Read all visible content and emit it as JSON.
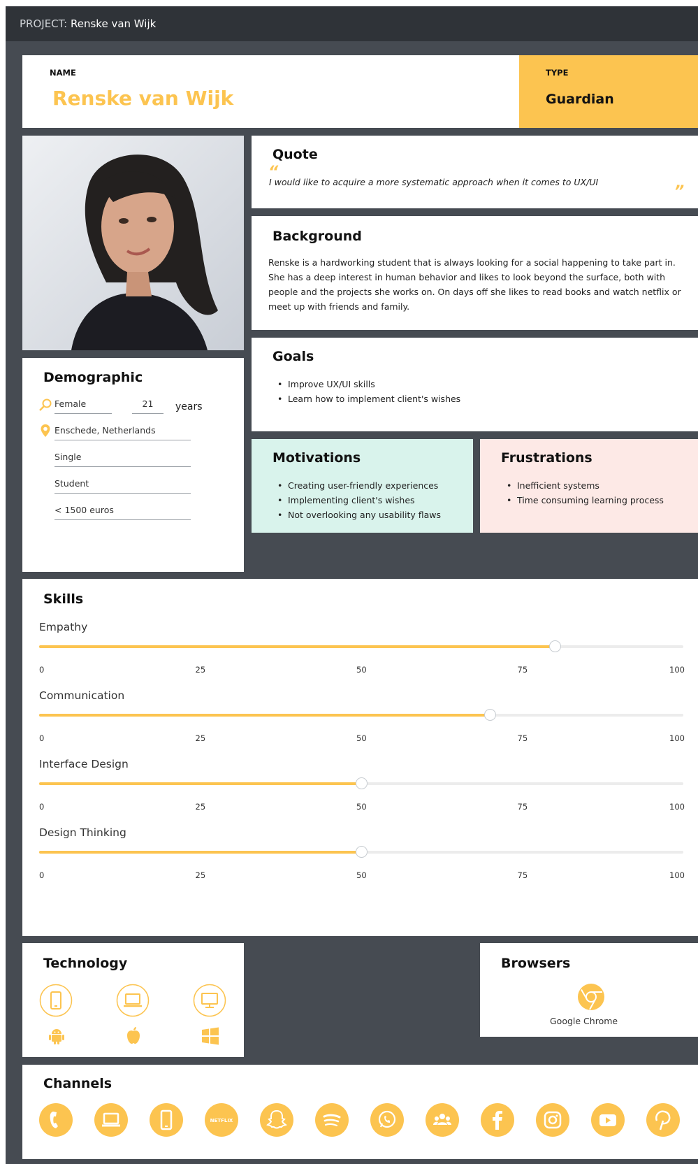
{
  "topbar": {
    "prefix": "PROJECT:",
    "project_name": "Renske van Wijk"
  },
  "header": {
    "name_label": "NAME",
    "name_value": "Renske van Wijk",
    "type_label": "TYPE",
    "type_value": "Guardian"
  },
  "quote": {
    "title": "Quote",
    "open_mark": "“",
    "text": "I would like to acquire a more systematic approach when it comes to UX/UI",
    "close_mark": "”"
  },
  "background": {
    "title": "Background",
    "text": "Renske is a hardworking student that is always looking for a social happening to take part in. She has a deep interest in human behavior and likes to look beyond the surface, both with people and the projects she works on. On days off she likes to read books and watch netflix or meet up with friends and family."
  },
  "goals": {
    "title": "Goals",
    "items": [
      "Improve UX/UI skills",
      "Learn how to implement client's wishes"
    ]
  },
  "demographic": {
    "title": "Demographic",
    "gender": "Female",
    "age": "21",
    "age_unit": "years",
    "location": "Enschede, Netherlands",
    "relationship": "Single",
    "occupation": "Student",
    "income": "< 1500 euros",
    "gender_icon": "female-search-icon",
    "location_icon": "location-pin-icon"
  },
  "motivations": {
    "title": "Motivations",
    "items": [
      "Creating user-friendly experiences",
      "Implementing client's wishes",
      "Not overlooking any usability flaws"
    ]
  },
  "frustrations": {
    "title": "Frustrations",
    "items": [
      "Inefficient systems",
      "Time consuming learning process"
    ]
  },
  "skills": {
    "title": "Skills",
    "ticks": [
      "0",
      "25",
      "50",
      "75",
      "100"
    ],
    "items": [
      {
        "name": "Empathy",
        "value": 80
      },
      {
        "name": "Communication",
        "value": 70
      },
      {
        "name": "Interface Design",
        "value": 50
      },
      {
        "name": "Design Thinking",
        "value": 50
      }
    ]
  },
  "technology": {
    "title": "Technology",
    "devices": [
      "smartphone-icon",
      "laptop-icon",
      "desktop-icon"
    ],
    "platforms": [
      "android-icon",
      "apple-icon",
      "windows-icon"
    ]
  },
  "browsers": {
    "title": "Browsers",
    "items": [
      {
        "name": "Google Chrome",
        "icon": "chrome-icon"
      }
    ]
  },
  "channels": {
    "title": "Channels",
    "icons": [
      "phone-icon",
      "laptop-icon",
      "smartphone-icon",
      "netflix-icon",
      "snapchat-icon",
      "spotify-icon",
      "whatsapp-icon",
      "community-icon",
      "facebook-icon",
      "instagram-icon",
      "youtube-icon",
      "pinterest-icon"
    ],
    "netflix_text": "NETFLIX"
  },
  "colors": {
    "accent": "#fcc450",
    "dark": "#464b52",
    "topbar": "#2f3338",
    "mint": "#d9f3ec",
    "blush": "#fde9e6"
  }
}
